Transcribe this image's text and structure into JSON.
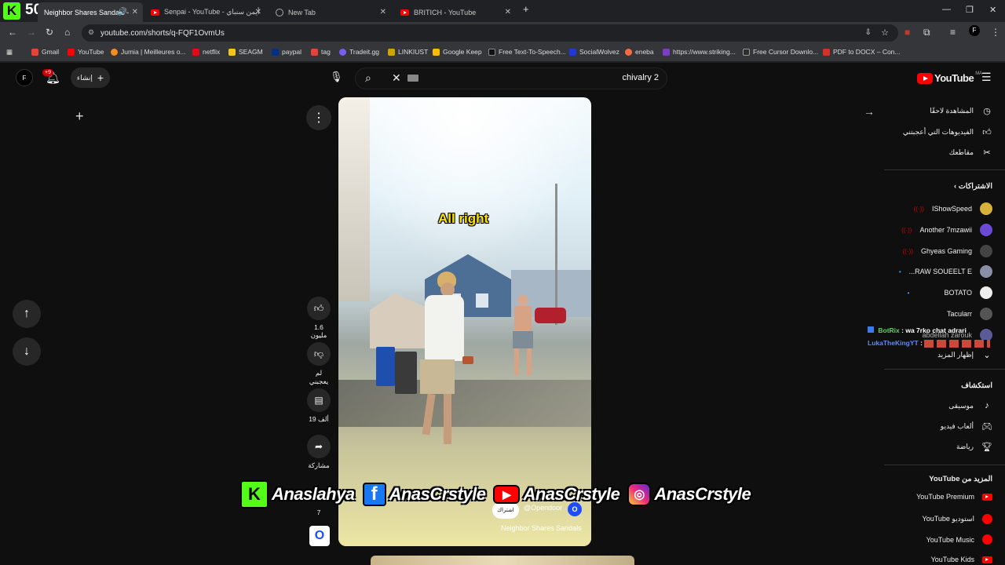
{
  "browser": {
    "kick_count": "50",
    "tabs": [
      {
        "title": "Neighbor Shares Sandals -"
      },
      {
        "title": "Senpai - YouTube - أيمن سنباي"
      },
      {
        "title": "New Tab"
      },
      {
        "title": "BRITICH - YouTube"
      }
    ],
    "url": "youtube.com/shorts/q-FQF1OvmUs",
    "bookmarks": [
      "Gmail",
      "YouTube",
      "Jumia | Meilleures o...",
      "netflix",
      "SEAGM",
      "paypal",
      "tag",
      "Tradeit.gg",
      "LINKIUST",
      "Google Keep",
      "Free Text-To-Speech...",
      "SocialWolvez",
      "eneba",
      "https://www.striking...",
      "Free Cursor Downlo...",
      "PDF to DOCX – Con..."
    ]
  },
  "masthead": {
    "avatar_letter": "F",
    "notif_count": "+9",
    "create_label": "إنشاء",
    "search_value": "chivalry 2",
    "logo_text": "YouTube",
    "region": "MA"
  },
  "video": {
    "caption": "All right",
    "channel": "@Opendoor",
    "subscribe": "اشتراك",
    "title": "Neighbor Shares Sandals"
  },
  "actions": {
    "likes": "1.6 مليون",
    "dislike": "لم يعجبني",
    "comments": "19 ألف",
    "share": "مشاركة",
    "remix_count": "7"
  },
  "sidebar": {
    "top_items": [
      "المشاهدة لاحقًا",
      "الفيديوهات التي أعجبتني",
      "مقاطعك"
    ],
    "subs_title": "الاشتراكات",
    "subs": [
      {
        "name": "IShowSpeed",
        "color": "#d8b13a"
      },
      {
        "name": "Another 7mzawii",
        "color": "#6b4bd6"
      },
      {
        "name": "Ghyeas Gaming",
        "color": "#444444"
      },
      {
        "name": "RAW SOUEELT E...",
        "color": "#8a8fa8"
      },
      {
        "name": "BOTATO",
        "color": "#eeeeee"
      },
      {
        "name": "Tacularr",
        "color": "#555555"
      },
      {
        "name": "abdellah zarouk",
        "color": "#7a7ad0"
      }
    ],
    "show_more": "إظهار المزيد",
    "explore_title": "استكشاف",
    "explore": [
      "موسيقى",
      "ألعاب فيديو",
      "رياضة"
    ],
    "more_title": "المزيد من YouTube",
    "more": [
      "YouTube Premium",
      "استوديو YouTube",
      "YouTube Music",
      "YouTube Kids"
    ]
  },
  "chat": [
    {
      "user": "BotRix",
      "text": ": wa 7rko chat adrari",
      "color": "#5bd35b"
    },
    {
      "user": "LukaTheKingYT",
      "text": " : ",
      "color": "#5e8cf0"
    }
  ],
  "overlay": {
    "kick": "Anaslahya",
    "facebook": "AnasCrstyle",
    "youtube": "AnasCrstyle",
    "instagram": "AnasCrstyle"
  }
}
